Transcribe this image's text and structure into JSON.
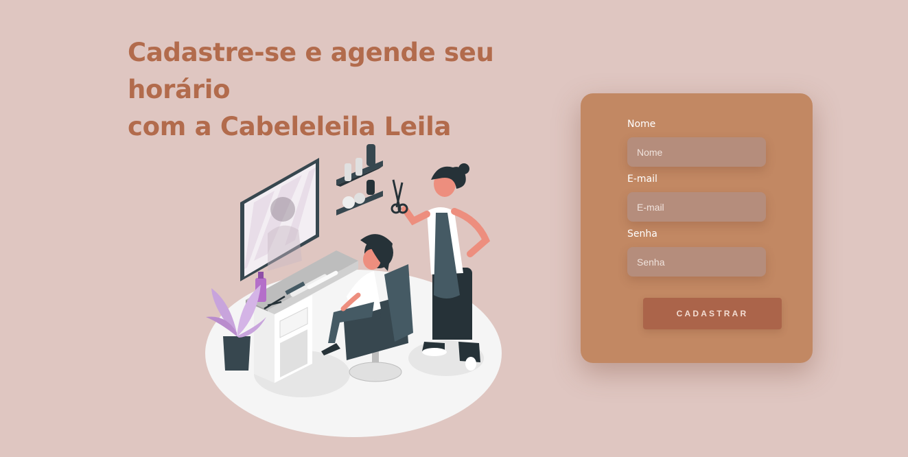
{
  "hero": {
    "title_line1": "Cadastre-se e agende seu horário",
    "title_line2": "com a Cabeleleila Leila"
  },
  "form": {
    "fields": [
      {
        "label": "Nome",
        "placeholder": "Nome"
      },
      {
        "label": "E-mail",
        "placeholder": "E-mail"
      },
      {
        "label": "Senha",
        "placeholder": "Senha"
      }
    ],
    "submit_label": "CADASTRAR"
  },
  "colors": {
    "background": "#dfc6c1",
    "accent": "#b26b4c",
    "card": "#c28863",
    "input": "#b58d7c",
    "button": "#ab644a"
  },
  "illustration": {
    "subject": "hairdresser-salon-illustration"
  }
}
